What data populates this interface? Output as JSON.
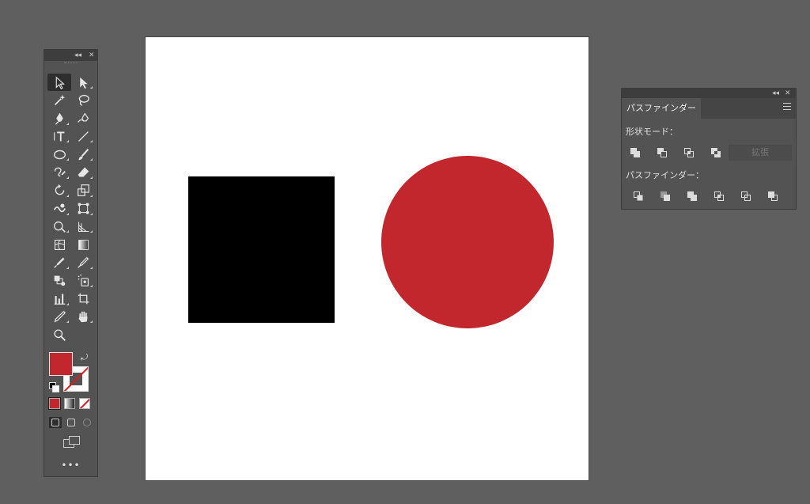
{
  "colors": {
    "fill": "#c1272d",
    "artboard": "#ffffff",
    "workspace": "#5f5f5f"
  },
  "tools_panel": {
    "tools": [
      [
        "selection-tool-icon",
        "direct-selection-tool-icon"
      ],
      [
        "magic-wand-tool-icon",
        "lasso-tool-icon"
      ],
      [
        "pen-tool-icon",
        "curvature-tool-icon"
      ],
      [
        "type-tool-icon",
        "line-segment-tool-icon"
      ],
      [
        "ellipse-tool-icon",
        "paintbrush-tool-icon"
      ],
      [
        "shaper-tool-icon",
        "eraser-tool-icon"
      ],
      [
        "rotate-tool-icon",
        "scale-tool-icon"
      ],
      [
        "warp-tool-icon",
        "free-transform-tool-icon"
      ],
      [
        "shape-builder-tool-icon",
        "perspective-grid-tool-icon"
      ],
      [
        "mesh-tool-icon",
        "gradient-tool-icon"
      ],
      [
        "eyedropper-tool-icon",
        "eyedropper2-tool-icon"
      ],
      [
        "blend-tool-icon",
        "symbol-sprayer-tool-icon"
      ],
      [
        "graph-tool-icon",
        "artboard-tool-icon"
      ],
      [
        "slice-tool-icon",
        "hand-tool-icon"
      ],
      [
        "zoom-tool-icon"
      ]
    ],
    "more_label": "•••"
  },
  "pathfinder_panel": {
    "tab_label": "パスファインダー",
    "shape_modes_label": "形状モード：",
    "pathfinders_label": "パスファインダー：",
    "expand_label": "拡張",
    "shape_mode_icons": [
      "unite-icon",
      "minus-front-icon",
      "intersect-icon",
      "exclude-icon"
    ],
    "pathfinder_icons": [
      "divide-icon",
      "trim-icon",
      "merge-icon",
      "crop-icon",
      "outline-icon",
      "minus-back-icon"
    ]
  }
}
